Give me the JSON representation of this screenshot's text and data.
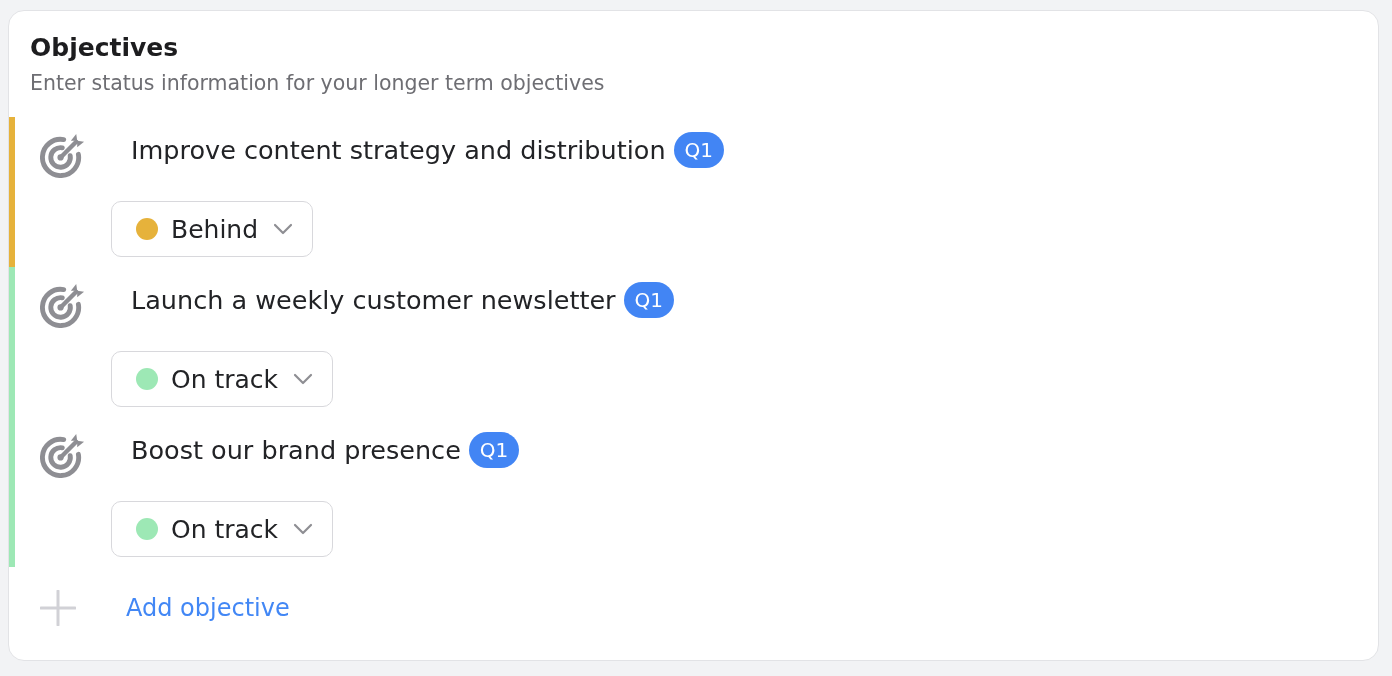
{
  "header": {
    "title": "Objectives",
    "subtitle": "Enter status information for your longer term objectives"
  },
  "objectives": [
    {
      "title": "Improve content strategy and distribution",
      "badge": "Q1",
      "status": {
        "label": "Behind",
        "color": "#e6b23b"
      }
    },
    {
      "title": "Launch a weekly customer newsletter",
      "badge": "Q1",
      "status": {
        "label": "On track",
        "color": "#9de8b5"
      }
    },
    {
      "title": "Boost our brand presence",
      "badge": "Q1",
      "status": {
        "label": "On track",
        "color": "#9de8b5"
      }
    }
  ],
  "add_button": {
    "label": "Add objective"
  }
}
